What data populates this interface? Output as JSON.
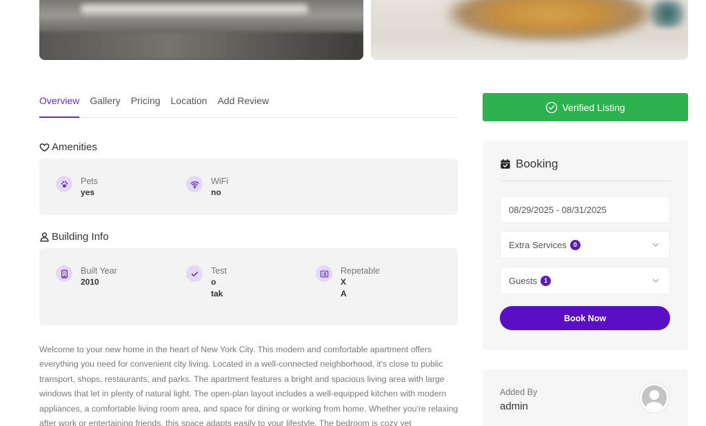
{
  "tabs": [
    {
      "label": "Overview",
      "active": true
    },
    {
      "label": "Gallery"
    },
    {
      "label": "Pricing"
    },
    {
      "label": "Location"
    },
    {
      "label": "Add Review"
    }
  ],
  "amenities": {
    "title": "Amenities",
    "icon": "heart-icon",
    "items": [
      {
        "label": "Pets",
        "value": "yes",
        "icon": "paw-icon"
      },
      {
        "label": "WiFi",
        "value": "no",
        "icon": "wifi-icon"
      }
    ]
  },
  "building": {
    "title": "Building Info",
    "icon": "user-icon",
    "items": [
      {
        "label": "Built Year",
        "value": "2010",
        "icon": "building-icon"
      },
      {
        "label": "Test",
        "value": "o",
        "value2": "tak",
        "icon": "check-icon"
      },
      {
        "label": "Repetable",
        "value": "X",
        "value2": "A",
        "icon": "list-icon"
      }
    ]
  },
  "description": "Welcome to your new home in the heart of New York City. This modern and comfortable apartment offers everything you need for convenient city living. Located in a well-connected neighborhood, it's close to public transport, shops, restaurants, and parks. The apartment features a bright and spacious living area with large windows that let in plenty of natural light. The open-plan layout includes a well-equipped kitchen with modern appliances, a comfortable living room area, and space for dining or working from home. Whether you're relaxing after work or entertaining friends, this space adapts easily to your lifestyle. The bedroom is cozy yet",
  "verified": {
    "label": "Verified Listing",
    "color": "#2eb24f"
  },
  "booking": {
    "title": "Booking",
    "dates": "08/29/2025 - 08/31/2025",
    "extra_services": {
      "label": "Extra Services",
      "count": "0"
    },
    "guests": {
      "label": "Guests",
      "count": "1"
    },
    "book_label": "Book Now"
  },
  "added_by": {
    "label": "Added By",
    "name": "admin"
  },
  "colors": {
    "accent": "#6a2bbd",
    "button": "#5a0fc4",
    "verified": "#2eb24f"
  }
}
